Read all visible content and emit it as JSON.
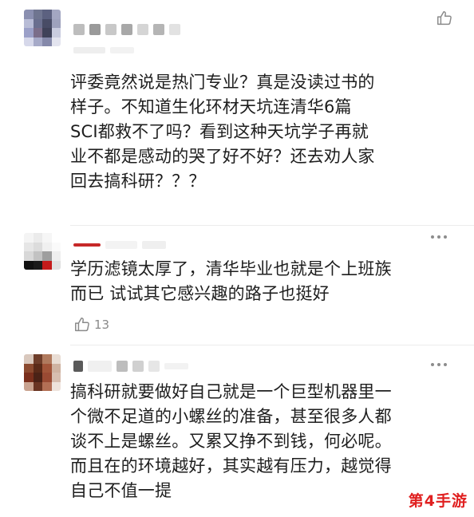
{
  "comments": [
    {
      "text": "评委竟然说是热门专业？真是没读过书的\n样子。不知道生化环材天坑连清华6篇\nSCI都救不了吗？看到这种天坑学子再就\n业不都是感动的哭了好不好？还去劝人家\n回去搞科研？？？",
      "like_count": ""
    },
    {
      "text": "学历滤镜太厚了，清华毕业也就是个上班族\n而已 试试其它感兴趣的路子也挺好",
      "like_count": "13"
    },
    {
      "text": "搞科研就要做好自己就是一个巨型机器里一\n个微不足道的小螺丝的准备，甚至很多人都\n谈不上是螺丝。又累又挣不到钱，何必呢。\n而且在的环境越好，其实越有压力，越觉得\n自己不值一提",
      "like_count": ""
    }
  ],
  "icons": {
    "like": "thumbs-up-icon",
    "more": "more-dots-icon"
  },
  "watermark": "第4手游",
  "colors": {
    "watermark": "#e02020",
    "meta_gray": "#8a8a8a"
  }
}
